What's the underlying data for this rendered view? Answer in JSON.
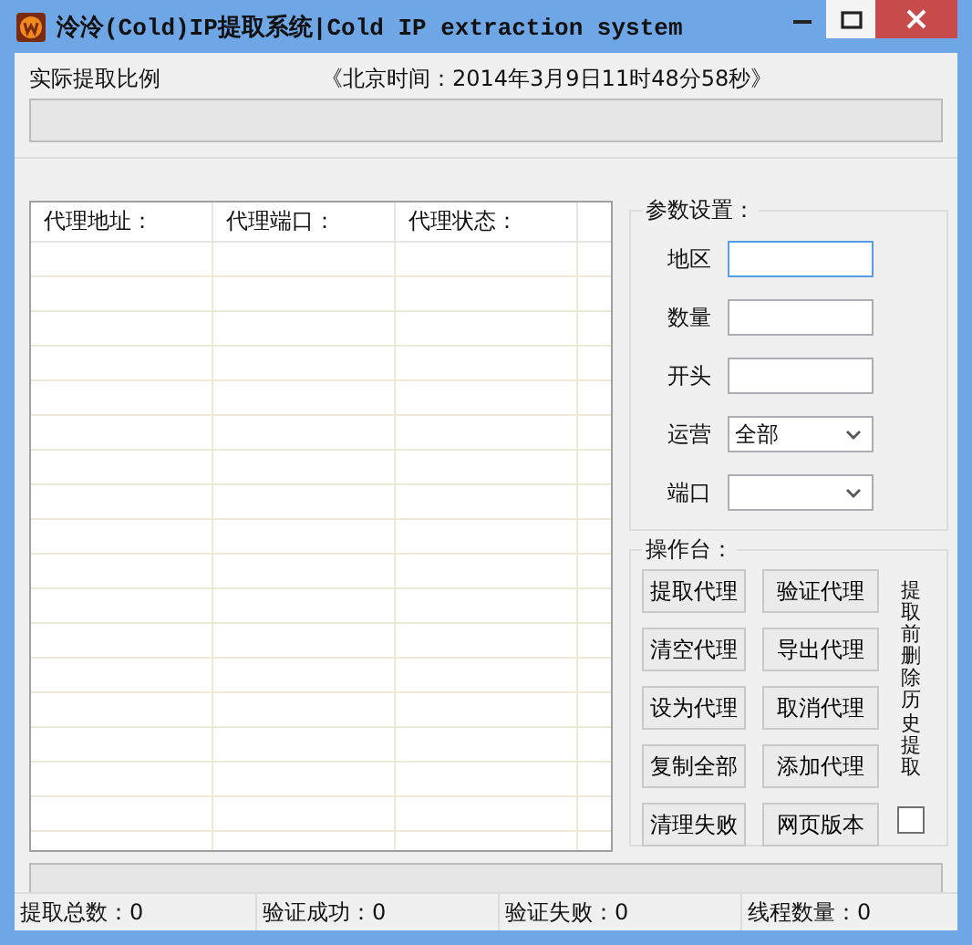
{
  "window": {
    "title": "泠泠(Cold)IP提取系统|Cold IP extraction system"
  },
  "extract_ratio": {
    "label": "实际提取比例",
    "clock": "《北京时间：2014年3月9日11时48分58秒》",
    "level": 0
  },
  "table": {
    "columns": [
      "代理地址：",
      "代理端口：",
      "代理状态："
    ]
  },
  "params": {
    "title": "参数设置：",
    "fields": [
      {
        "label": "地区",
        "kind": "text",
        "focused": true
      },
      {
        "label": "数量",
        "kind": "text",
        "focused": false
      },
      {
        "label": "开头",
        "kind": "text",
        "focused": false
      },
      {
        "label": "运营",
        "kind": "select",
        "value": "全部",
        "focused": false
      },
      {
        "label": "端口",
        "kind": "select",
        "focused": false
      }
    ]
  },
  "operations": {
    "title": "操作台：",
    "buttons": [
      "提取代理",
      "验证代理",
      "清空代理",
      "导出代理",
      "设为代理",
      "取消代理",
      "复制全部",
      "添加代理",
      "清理失败",
      "网页版本"
    ],
    "option": {
      "label": "提取前删除历史提取",
      "checked": false
    }
  },
  "progress": {
    "level": 0
  },
  "status_bar": [
    "提取总数：0",
    "验证成功：0",
    "验证失败：0",
    "线程数量：0"
  ]
}
